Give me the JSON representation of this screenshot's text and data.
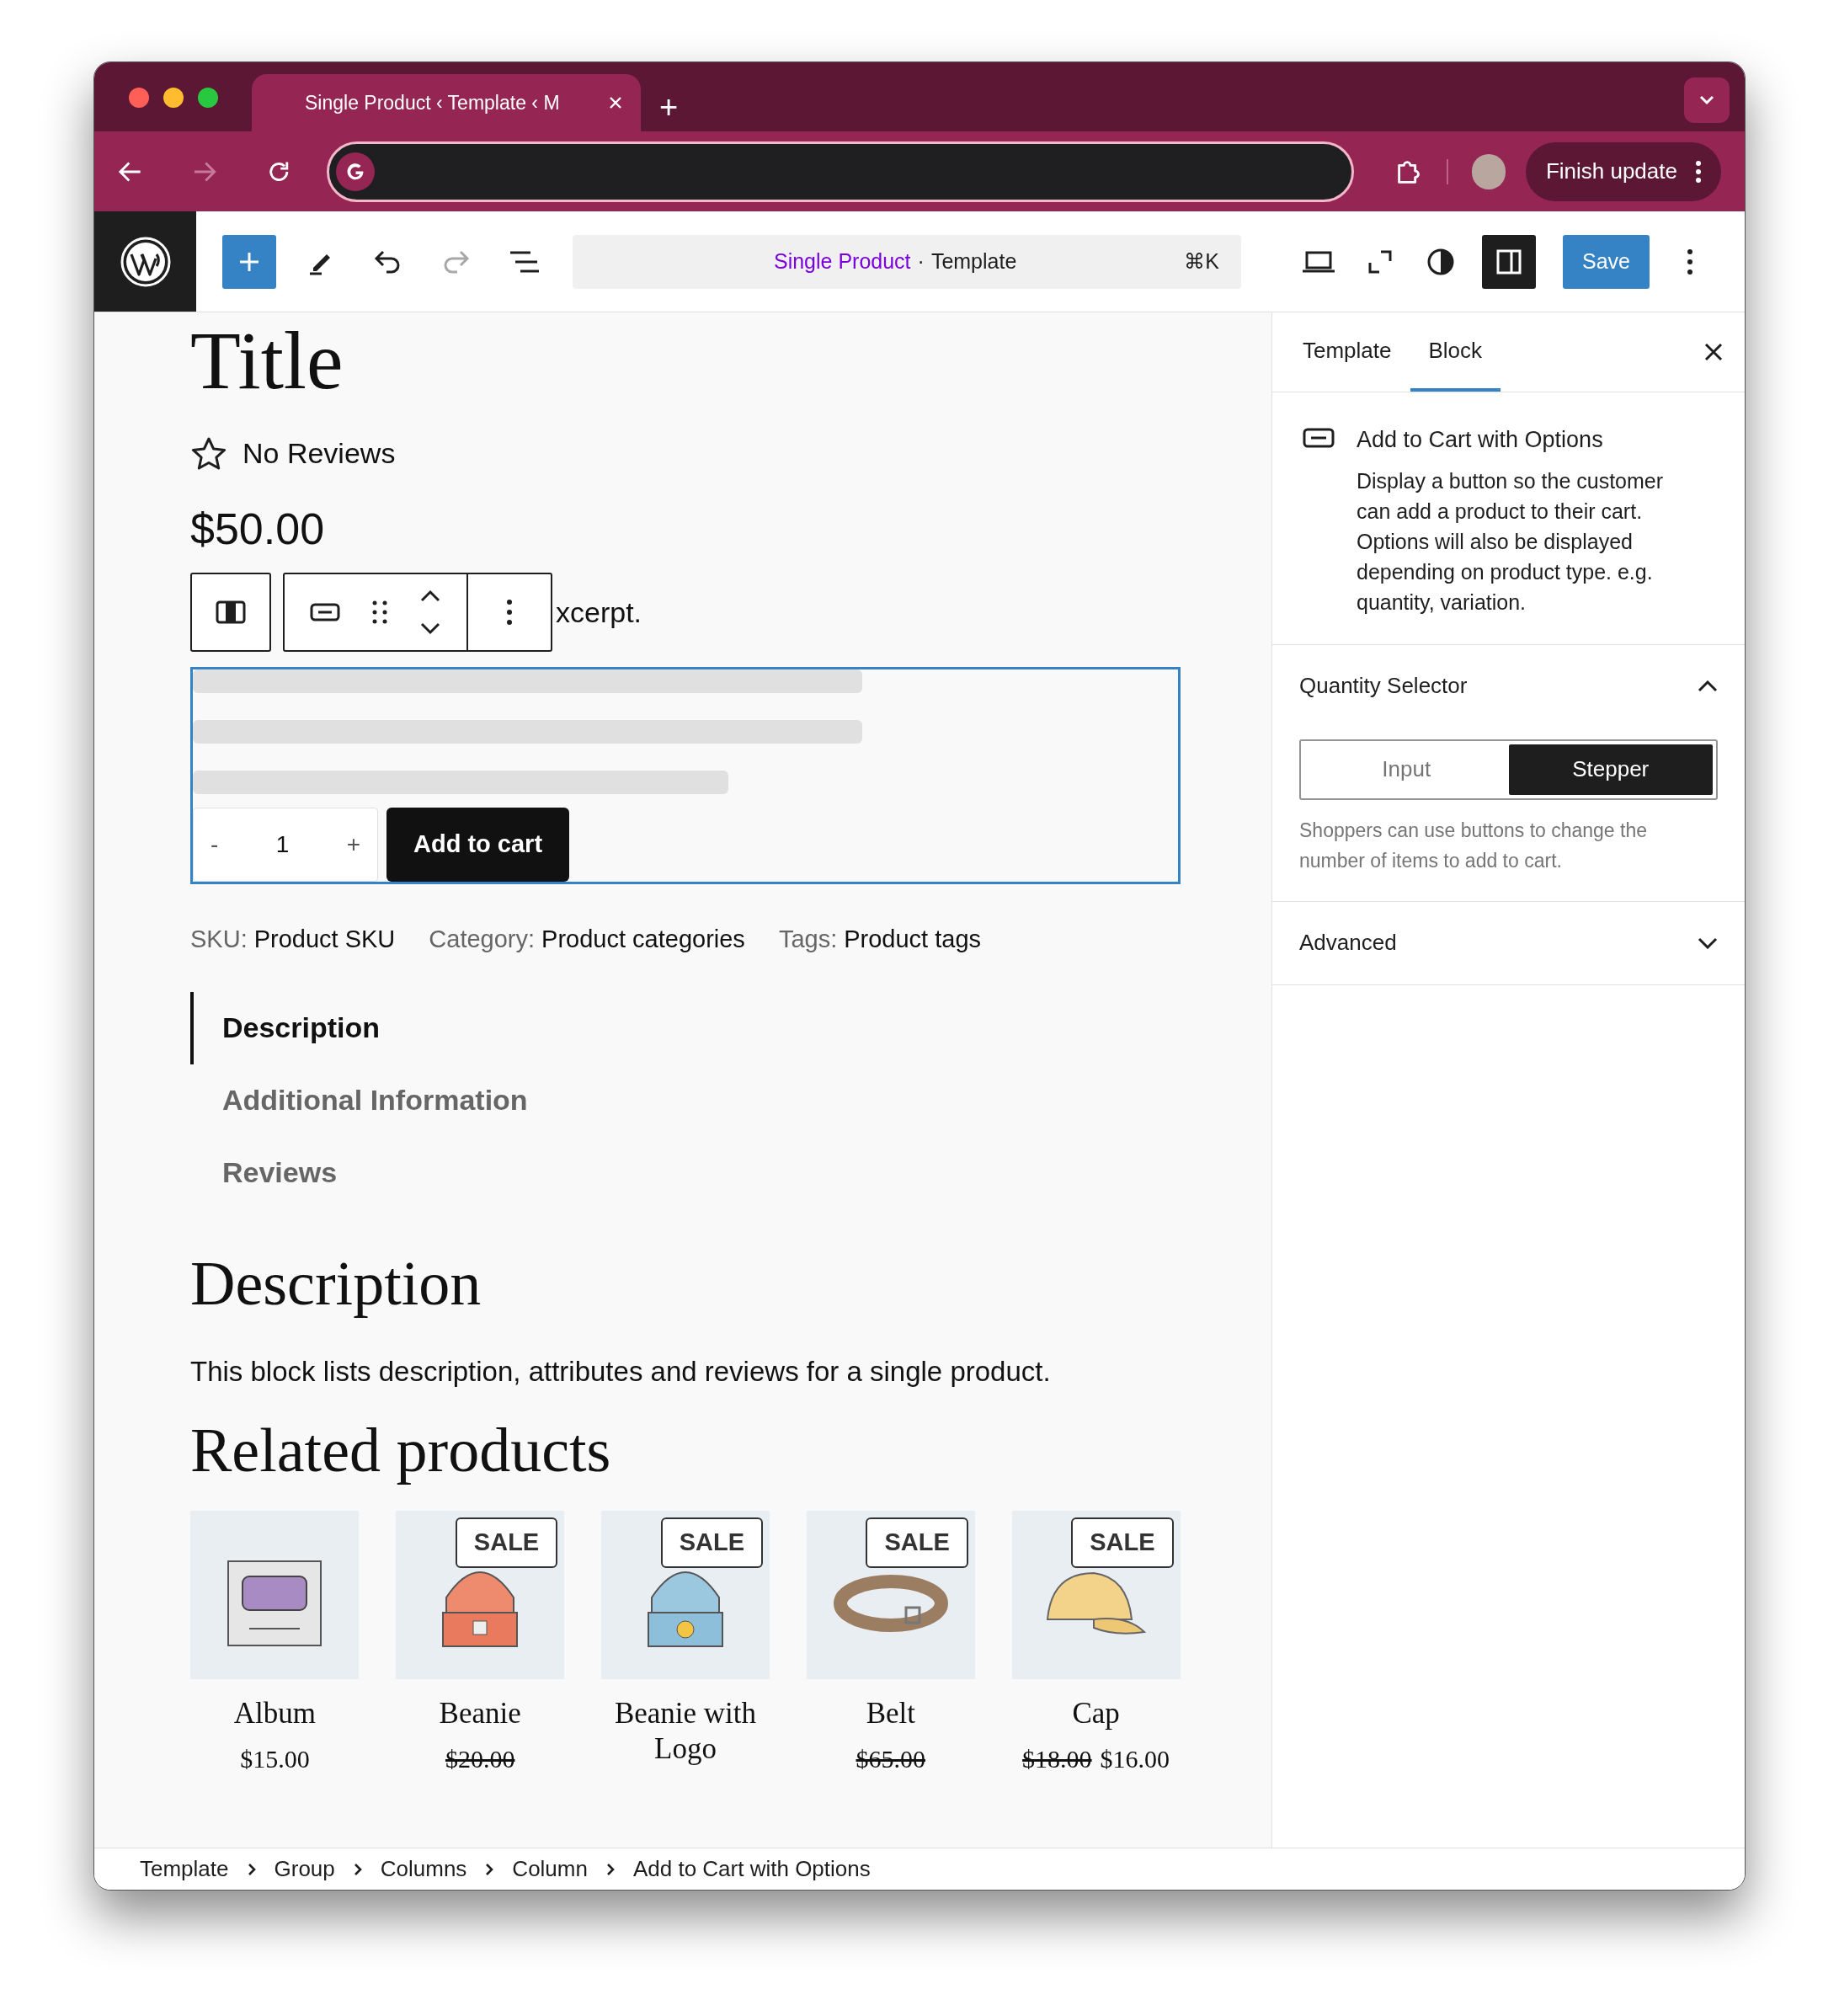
{
  "browser": {
    "tab_title": "Single Product ‹ Template ‹ M",
    "new_tab": "+",
    "forward_disabled": true,
    "update_button": "Finish update"
  },
  "editor_toolbar": {
    "document_title": "Single Product",
    "separator": "·",
    "document_type": "Template",
    "shortcut": "⌘K",
    "redo_disabled": true,
    "sidebar_toggle_pressed": true,
    "save_label": "Save"
  },
  "content": {
    "title": "Title",
    "rating_text": "No Reviews",
    "price": "$50.00",
    "excerpt_fragment": "xcerpt.",
    "quantity": {
      "minus": "-",
      "value": "1",
      "plus": "+"
    },
    "add_to_cart": "Add to cart",
    "meta": [
      {
        "label": "SKU:",
        "value": "Product SKU"
      },
      {
        "label": "Category:",
        "value": "Product categories"
      },
      {
        "label": "Tags:",
        "value": "Product tags"
      }
    ],
    "tabs": [
      {
        "label": "Description",
        "selected": true
      },
      {
        "label": "Additional Information",
        "selected": false
      },
      {
        "label": "Reviews",
        "selected": false
      }
    ],
    "description_heading": "Description",
    "description_text": "This block lists description, attributes and reviews for a single product.",
    "related_heading": "Related products",
    "products": [
      {
        "name": "Album",
        "kind": "album",
        "prices": [
          {
            "text": "$15.00",
            "struck": false
          }
        ]
      },
      {
        "name": "Beanie",
        "kind": "beanie",
        "badge": "SALE",
        "prices": [
          {
            "text": "$20.00",
            "struck": true
          }
        ]
      },
      {
        "name": "Beanie with Logo",
        "kind": "beanie-logo",
        "badge": "SALE"
      },
      {
        "name": "Belt",
        "kind": "belt",
        "badge": "SALE",
        "prices": [
          {
            "text": "$65.00",
            "struck": true
          }
        ]
      },
      {
        "name": "Cap",
        "kind": "cap",
        "badge": "SALE",
        "prices": [
          {
            "text": "$18.00",
            "struck": true
          },
          {
            "text": "$16.00",
            "struck": false
          }
        ]
      }
    ]
  },
  "sidebar": {
    "tabs": [
      {
        "label": "Template",
        "selected": false
      },
      {
        "label": "Block",
        "selected": true
      }
    ],
    "block": {
      "title": "Add to Cart with Options",
      "description": "Display a button so the customer can add a product to their cart. Options will also be displayed depending on product type. e.g. quantity, variation."
    },
    "panels": [
      {
        "title": "Quantity Selector",
        "expanded": true,
        "options": [
          {
            "label": "Input",
            "selected": false
          },
          {
            "label": "Stepper",
            "selected": true
          }
        ],
        "help": "Shoppers can use buttons to change the number of items to add to cart."
      },
      {
        "title": "Advanced",
        "expanded": false
      }
    ]
  },
  "breadcrumb": [
    "Template",
    "Group",
    "Columns",
    "Column",
    "Add to Cart with Options"
  ]
}
